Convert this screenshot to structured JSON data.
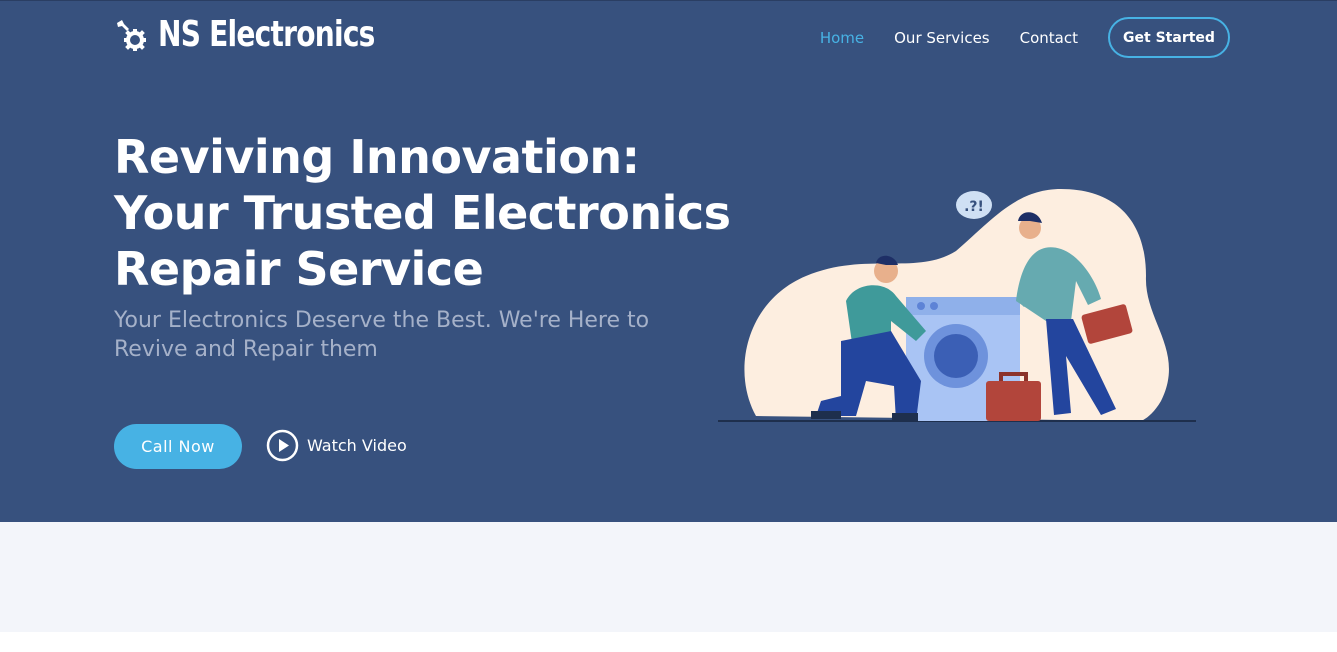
{
  "header": {
    "brand": "NS Electronics",
    "logo_icon": "gear-wrench-icon",
    "nav": [
      {
        "label": "Home",
        "active": true
      },
      {
        "label": "Our Services",
        "active": false
      },
      {
        "label": "Contact",
        "active": false
      }
    ],
    "cta_label": "Get Started"
  },
  "hero": {
    "headline_lines": [
      "Reviving Innovation:",
      "Your Trusted Electronics",
      "Repair Service"
    ],
    "subheadline": "Your Electronics Deserve the Best. We're Here to Revive and Repair them",
    "primary_button": "Call Now",
    "video_link": "Watch Video",
    "video_icon": "play-circle-icon",
    "illustration_bubble": ".?!"
  },
  "colors": {
    "hero_background": "#37517e",
    "accent": "#47b2e4",
    "subheadline": "#a5b1c9",
    "section_background": "#f3f5fa"
  }
}
